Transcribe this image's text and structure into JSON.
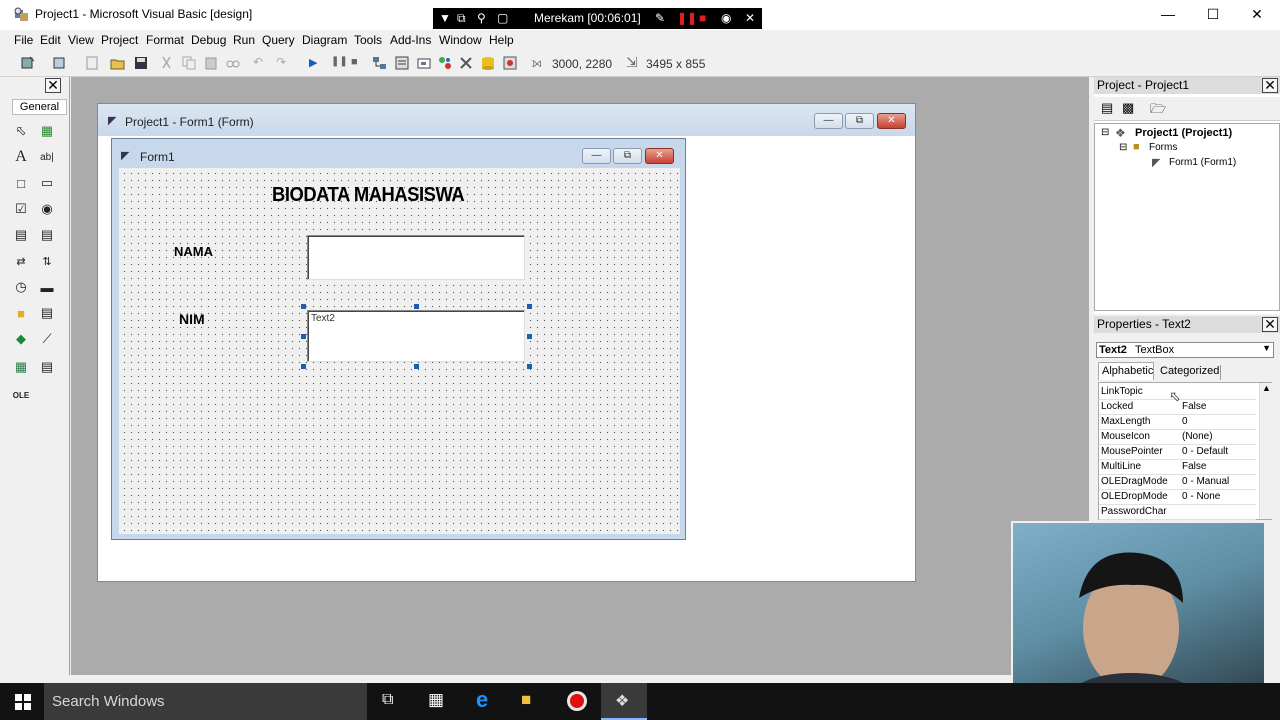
{
  "window": {
    "title": "Project1 - Microsoft Visual Basic [design]"
  },
  "recorder": {
    "label": "Merekam [00:06:01]"
  },
  "menu": {
    "items": [
      "File",
      "Edit",
      "View",
      "Project",
      "Format",
      "Debug",
      "Run",
      "Query",
      "Diagram",
      "Tools",
      "Add-Ins",
      "Window",
      "Help"
    ]
  },
  "toolbar": {
    "position": "3000, 2280",
    "size": "3495 x 855"
  },
  "toolbox": {
    "tab": "General"
  },
  "designer": {
    "title": "Project1 - Form1 (Form)"
  },
  "form1": {
    "caption": "Form1",
    "heading": "BIODATA MAHASISWA",
    "label_nama": "NAMA",
    "label_nim": "NIM",
    "text1_value": "",
    "text2_value": "Text2"
  },
  "project_explorer": {
    "title": "Project - Project1",
    "root": "Project1 (Project1)",
    "folder": "Forms",
    "form": "Form1 (Form1)"
  },
  "properties": {
    "title": "Properties - Text2",
    "object_name": "Text2",
    "object_type": "TextBox",
    "tab_alphabetic": "Alphabetic",
    "tab_categorized": "Categorized",
    "rows": [
      {
        "name": "LinkTopic",
        "value": ""
      },
      {
        "name": "Locked",
        "value": "False"
      },
      {
        "name": "MaxLength",
        "value": "0"
      },
      {
        "name": "MouseIcon",
        "value": "(None)"
      },
      {
        "name": "MousePointer",
        "value": "0 - Default"
      },
      {
        "name": "MultiLine",
        "value": "False"
      },
      {
        "name": "OLEDragMode",
        "value": "0 - Manual"
      },
      {
        "name": "OLEDropMode",
        "value": "0 - None"
      },
      {
        "name": "PasswordChar",
        "value": ""
      }
    ]
  },
  "taskbar": {
    "search_placeholder": "Search Windows"
  }
}
